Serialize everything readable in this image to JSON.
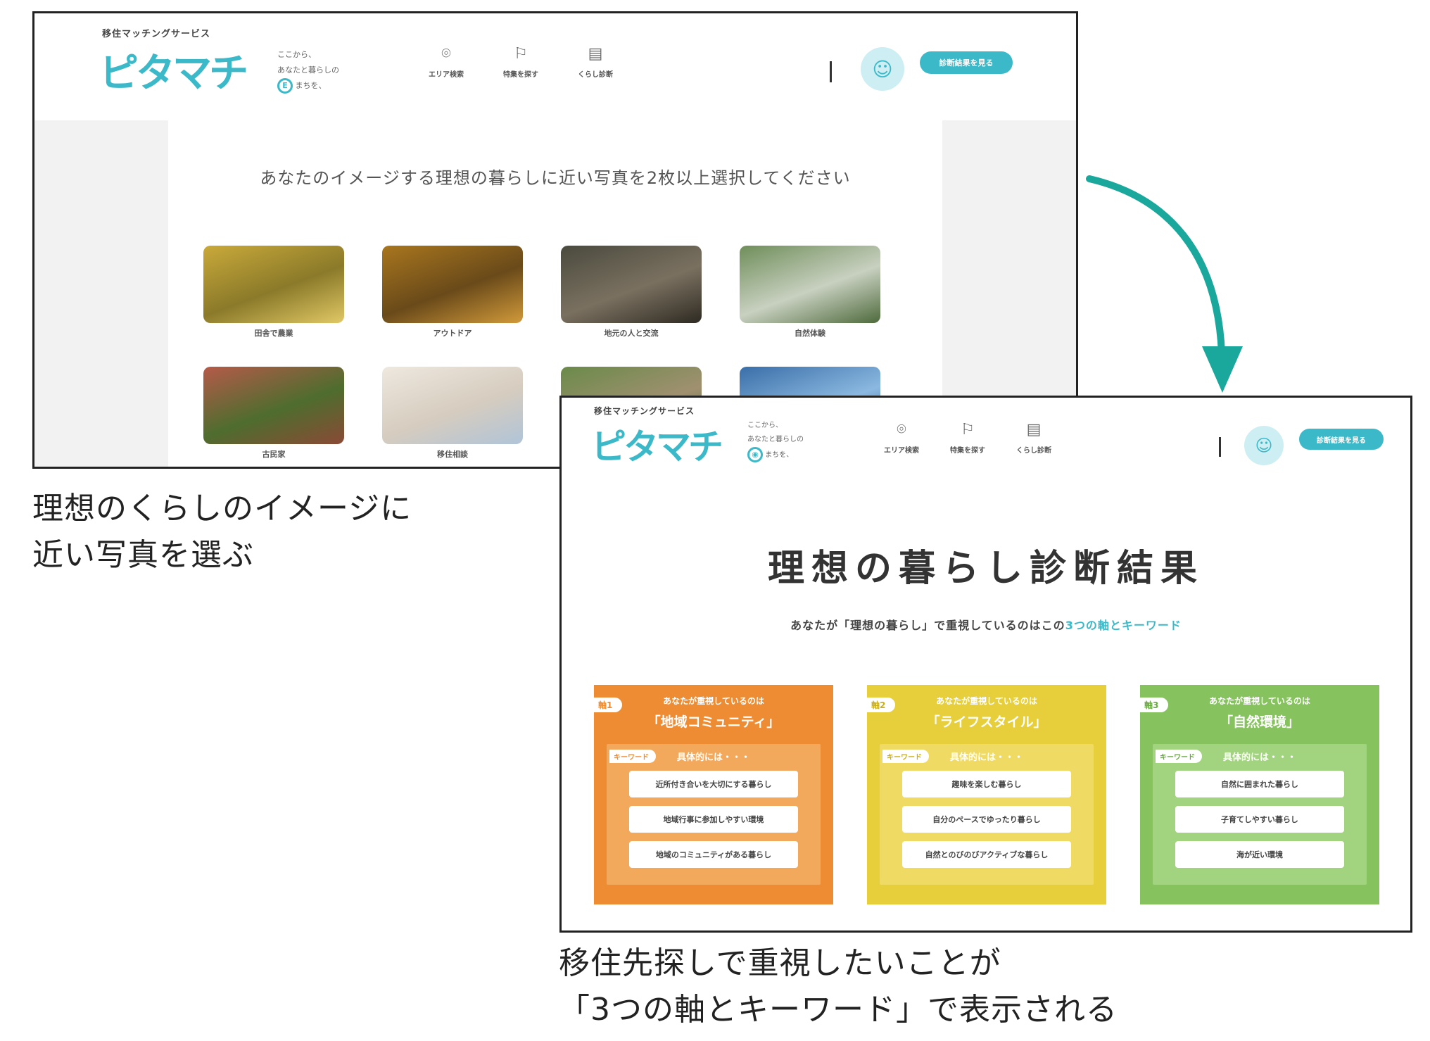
{
  "screen1": {
    "brand_sub": "移住マッチングサービス",
    "logo": "ピタマチ",
    "tagline": [
      "ここから、",
      "あなたと暮らしの",
      "まちを、"
    ],
    "tagline_icon_letter": "E",
    "nav": [
      {
        "icon": "location-pin-icon",
        "label": "エリア検索"
      },
      {
        "icon": "flag-icon",
        "label": "特集を探す"
      },
      {
        "icon": "calendar-icon",
        "label": "くらし診断"
      }
    ],
    "result_button": "診断結果を見る",
    "question": "あなたのイメージする理想の暮らしに近い写真を2枚以上選択してください",
    "photos": [
      {
        "label": "田舎で農業",
        "colors": [
          "#c9a93a",
          "#8b7a2a",
          "#e0c865"
        ]
      },
      {
        "label": "アウトドア",
        "colors": [
          "#a8761e",
          "#6a4a1a",
          "#d19a3a"
        ]
      },
      {
        "label": "地元の人と交流",
        "colors": [
          "#4a4a3e",
          "#7a7060",
          "#2e2a22"
        ]
      },
      {
        "label": "自然体験",
        "colors": [
          "#6f8e5a",
          "#c8d0c0",
          "#4e6a3c"
        ]
      },
      {
        "label": "古民家",
        "colors": [
          "#b55a4a",
          "#4e6d2e",
          "#8a4a36"
        ]
      },
      {
        "label": "移住相談",
        "colors": [
          "#eee8df",
          "#d6ccbf",
          "#b0c4d8"
        ]
      },
      {
        "label": "",
        "colors": [
          "#6a8a4a",
          "#a09070",
          "#4a6a3a"
        ]
      },
      {
        "label": "",
        "colors": [
          "#3a6ea8",
          "#8ab8e0",
          "#2a5a8e"
        ]
      }
    ]
  },
  "screen2": {
    "brand_sub": "移住マッチングサービス",
    "logo": "ピタマチ",
    "tagline": [
      "ここから、",
      "あなたと暮らしの",
      "まちを、"
    ],
    "nav": [
      {
        "icon": "location-pin-icon",
        "label": "エリア検索"
      },
      {
        "icon": "flag-icon",
        "label": "特集を探す"
      },
      {
        "icon": "calendar-icon",
        "label": "くらし診断"
      }
    ],
    "result_button": "診断結果を見る",
    "title": "理想の暮らし診断結果",
    "subline_pre": "あなたが「理想の暮らし」で重視しているのはこの",
    "subline_hl": "3つの軸とキーワード",
    "cards": [
      {
        "badge": "軸1",
        "lead": "あなたが重視しているのは",
        "axis": "「地域コミュニティ」",
        "kw_tag": "キーワード",
        "kw_lead": "具体的には・・・",
        "keywords": [
          "近所付き合いを大切にする暮らし",
          "地域行事に参加しやすい環境",
          "地域のコミュニティがある暮らし"
        ],
        "color": "#ee8c33",
        "inner": "#f3a95b",
        "accent": "#ee8c33"
      },
      {
        "badge": "軸2",
        "lead": "あなたが重視しているのは",
        "axis": "「ライフスタイル」",
        "kw_tag": "キーワード",
        "kw_lead": "具体的には・・・",
        "keywords": [
          "趣味を楽しむ暮らし",
          "自分のペースでゆったり暮らし",
          "自然とのびのびアクティブな暮らし"
        ],
        "color": "#e6cf3a",
        "inner": "#efdb63",
        "accent": "#c9ae1e"
      },
      {
        "badge": "軸3",
        "lead": "あなたが重視しているのは",
        "axis": "「自然環境」",
        "kw_tag": "キーワード",
        "kw_lead": "具体的には・・・",
        "keywords": [
          "自然に囲まれた暮らし",
          "子育てしやすい暮らし",
          "海が近い環境"
        ],
        "color": "#86c35e",
        "inner": "#a2d37e",
        "accent": "#6aa844"
      }
    ]
  },
  "caption1": [
    "理想のくらしのイメージに",
    "近い写真を選ぶ"
  ],
  "caption2": [
    "移住先探しで重視したいことが",
    "「3つの軸とキーワード」で表示される"
  ],
  "arrow_color": "#1aa89c"
}
